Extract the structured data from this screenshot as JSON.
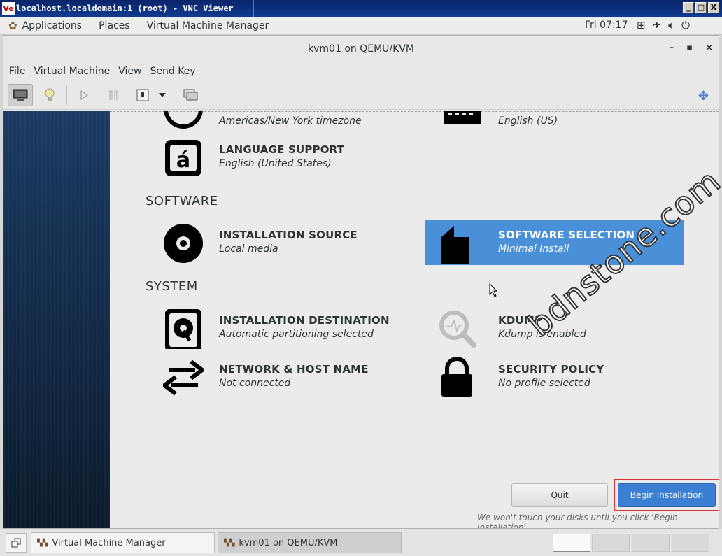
{
  "vnc": {
    "title": "localhost.localdomain:1 (root) - VNC Viewer",
    "logo": "Ve",
    "buttons": [
      "_",
      "□",
      "X"
    ]
  },
  "gnome": {
    "applications": "Applications",
    "places": "Places",
    "vmm": "Virtual Machine Manager",
    "clock": "Fri 07:17",
    "tray_icons": [
      "network-icon",
      "airplane-icon",
      "volume-icon",
      "power-icon"
    ]
  },
  "window": {
    "title": "kvm01 on QEMU/KVM",
    "controls": [
      "–",
      "▪",
      "×"
    ]
  },
  "menu": [
    "File",
    "Virtual Machine",
    "View",
    "Send Key"
  ],
  "hub": {
    "top_left_sub": "Americas/New York timezone",
    "top_right_sub": "English (US)",
    "language": {
      "title": "LANGUAGE SUPPORT",
      "status": "English (United States)"
    },
    "software_heading": "SOFTWARE",
    "source": {
      "title": "INSTALLATION SOURCE",
      "status": "Local media"
    },
    "selection": {
      "title": "SOFTWARE SELECTION",
      "status": "Minimal Install"
    },
    "system_heading": "SYSTEM",
    "destination": {
      "title": "INSTALLATION DESTINATION",
      "status": "Automatic partitioning selected"
    },
    "kdump": {
      "title": "KDUMP",
      "status": "Kdump is enabled"
    },
    "network": {
      "title": "NETWORK & HOST NAME",
      "status": "Not connected"
    },
    "security": {
      "title": "SECURITY POLICY",
      "status": "No profile selected"
    },
    "quit_label": "Quit",
    "begin_label": "Begin Installation",
    "hint": "We won't touch your disks until you click 'Begin Installation'."
  },
  "watermark": "bdnstone.com",
  "taskbar": {
    "task1": "Virtual Machine Manager",
    "task2": "kvm01 on QEMU/KVM"
  },
  "colors": {
    "accent": "#4a90d9",
    "begin": "#3b7fd5",
    "highlight_border": "#dd3333"
  }
}
